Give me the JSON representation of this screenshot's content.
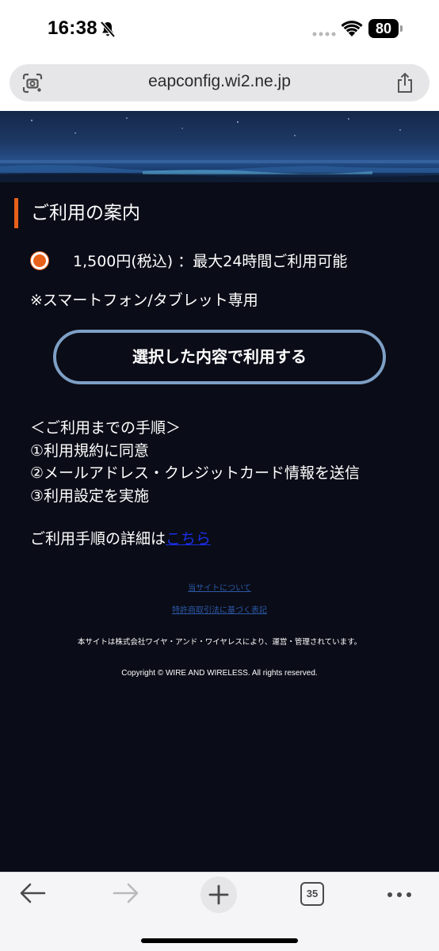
{
  "status_bar": {
    "time": "16:38",
    "battery": "80",
    "icons": [
      "bell-muted-icon",
      "signal-icon",
      "wifi-icon",
      "battery-icon"
    ]
  },
  "browser": {
    "url": "eapconfig.wi2.ne.jp",
    "tab_count": "35",
    "icons": [
      "lens-icon",
      "share-icon",
      "back-arrow-icon",
      "forward-arrow-icon",
      "plus-icon",
      "more-dots-icon"
    ]
  },
  "page": {
    "section_title": "ご利用の案内",
    "plan": {
      "label": "1,500円(税込) ：最大24時間ご利用可能",
      "selected": true
    },
    "device_note": "※スマートフォン/タブレット専用",
    "submit_label": "選択した内容で利用する",
    "steps": [
      "＜ご利用までの手順＞",
      "①利用規約に同意",
      "②メールアドレス・クレジットカード情報を送信",
      "③利用設定を実施"
    ],
    "details_prefix": "ご利用手順の詳細は",
    "details_link": "こちら",
    "footer": {
      "about_link": "当サイトについて",
      "law_link": "特許商取引法に基づく表記",
      "operator": "本サイトは株式会社ワイヤ・アンド・ワイヤレスにより、運営・管理されています。",
      "copyright": "Copyright © WIRE AND WIRELESS. All rights reserved."
    }
  },
  "colors": {
    "page_background": "#0a0c17",
    "accent_orange": "#e8611a",
    "button_border": "#7ea0c6",
    "link_blue": "#1a2ee6"
  }
}
